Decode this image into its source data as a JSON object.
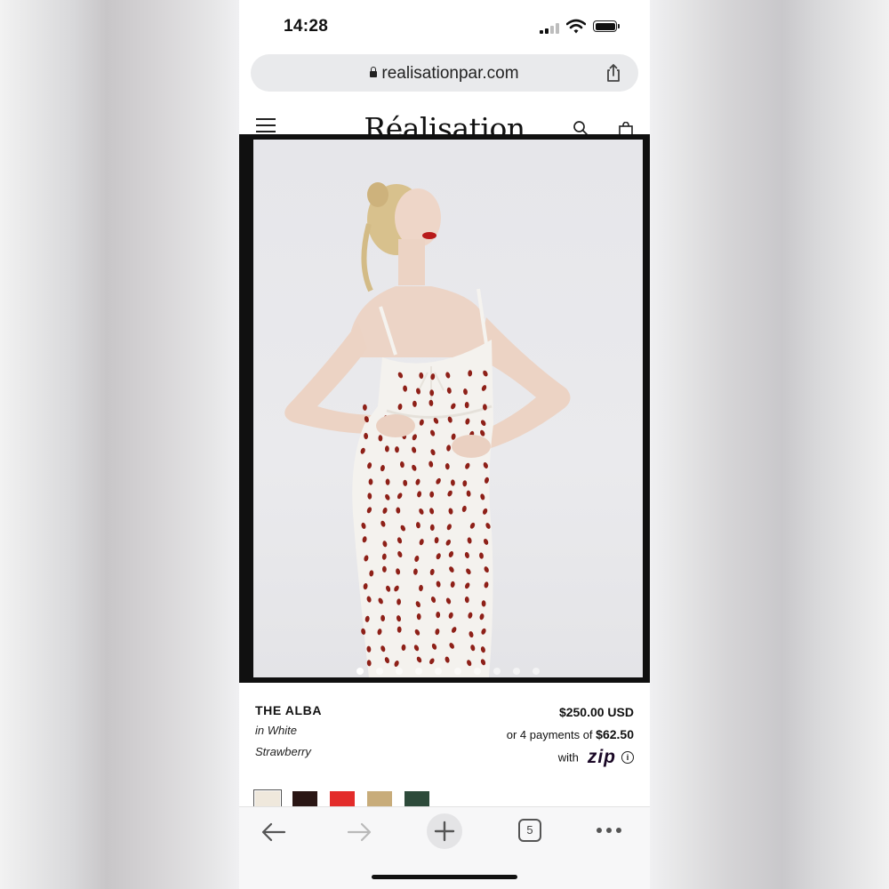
{
  "status_bar": {
    "time": "14:28"
  },
  "browser": {
    "url": "realisationpar.com",
    "tab_count": "5"
  },
  "site": {
    "logo": "Réalisation"
  },
  "product": {
    "name": "THE ALBA",
    "color_line": "in White Strawberry",
    "price": "$250.00 USD",
    "installments_prefix": "or 4 payments of",
    "installment_amount": "$62.50",
    "with_label": "with",
    "zip_logo": "zip",
    "carousel_total_images": 10,
    "carousel_active_index": 0,
    "swatches": [
      {
        "color": "#efe8dc",
        "selected": true
      },
      {
        "color": "#2a1614"
      },
      {
        "color": "#e32c2a"
      },
      {
        "color": "#c8ac7a"
      },
      {
        "color": "#2d4a3a"
      }
    ]
  },
  "colors": {
    "accent_zip": "#6b2de0"
  }
}
